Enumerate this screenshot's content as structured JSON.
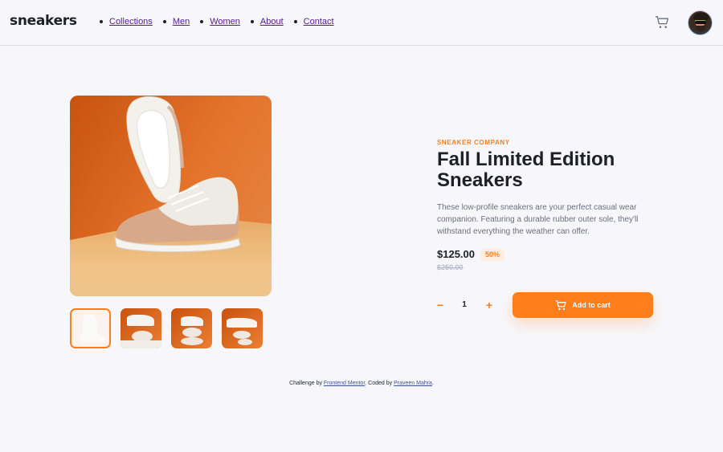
{
  "header": {
    "logo": "sneakers",
    "nav": [
      "Collections",
      "Men",
      "Women",
      "About",
      "Contact"
    ],
    "cart_icon": "cart-icon",
    "avatar_icon": "user-avatar"
  },
  "product": {
    "company": "SNEAKER COMPANY",
    "title": "Fall Limited Edition Sneakers",
    "description": "These low-profile sneakers are your perfect casual wear companion. Featuring a durable rubber outer sole, they'll withstand everything the weather can offer.",
    "price": "$125.00",
    "discount": "50%",
    "original_price": "$250.00",
    "quantity": "1",
    "add_to_cart": "Add to cart",
    "minus_symbol": "−",
    "plus_symbol": "+"
  },
  "gallery": {
    "thumbnail_count": 4,
    "active_thumbnail": 1
  },
  "footer": {
    "prefix": "Challenge by ",
    "link1": "Frontend Mentor",
    "middle": ". Coded by ",
    "link2": "Praveen Mahra",
    "suffix": "."
  },
  "colors": {
    "accent": "#ff7d1a",
    "accent_light": "#ffede0",
    "text_dark": "#1d2026",
    "text_muted": "#68707d",
    "background": "#f7f7fb"
  }
}
